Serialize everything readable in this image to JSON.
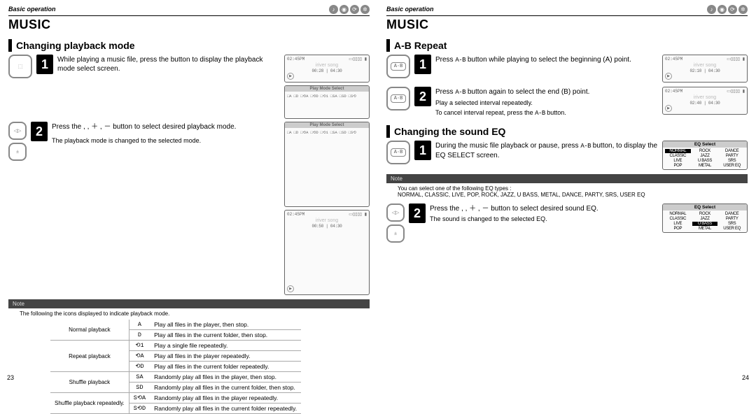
{
  "header": {
    "breadcrumb": "Basic operation",
    "icon_names": [
      "note",
      "globe",
      "clock",
      "gear"
    ]
  },
  "music_heading": "MUSIC",
  "left": {
    "section": "Changing playback mode",
    "step1": "While playing a music file, press the         button to display the playback mode select screen.",
    "step2_a": "Press the        ,     , ＋ , － button to select desired playback mode.",
    "step2_b": "The playback mode is changed to the selected mode.",
    "lcd1_mid": "iriver song",
    "lcd1_time": "00:28 | 04:30",
    "lcd_sel_title": "Play Mode Select",
    "lcd3_time": "00:50 | 04:30",
    "note_label": "Note",
    "note_intro": "The following the icons displayed to indicate playback mode.",
    "modes": [
      {
        "group": "Normal playback",
        "rows": [
          {
            "icon": "A",
            "desc": "Play all files in the player, then stop."
          },
          {
            "icon": "D",
            "desc": "Play all files in the current folder, then stop."
          }
        ]
      },
      {
        "group": "Repeat playback",
        "rows": [
          {
            "icon": "⟲1",
            "desc": "Play a single file repeatedly."
          },
          {
            "icon": "⟲A",
            "desc": "Play all files in the player repeatedly."
          },
          {
            "icon": "⟲D",
            "desc": "Play all files in the current folder repeatedly."
          }
        ]
      },
      {
        "group": "Shuffle playback",
        "rows": [
          {
            "icon": "SA",
            "desc": "Randomly play all files in the player, then stop."
          },
          {
            "icon": "SD",
            "desc": "Randomly play all files in the current folder, then stop."
          }
        ]
      },
      {
        "group": "Shuffle playback repeatedly.",
        "rows": [
          {
            "icon": "S⟲A",
            "desc": "Randomly play all files in the player repeatedly."
          },
          {
            "icon": "S⟲D",
            "desc": "Randomly play all files in the current folder repeatedly."
          }
        ]
      }
    ],
    "page_no": "23"
  },
  "right": {
    "section_ab": "A-B Repeat",
    "ab_btn": "A·B",
    "ab_sym": "A-B",
    "ab_step1": "Press A-B button while playing to select the beginning (A) point.",
    "ab_step2_a": "Press A-B button again to select the end (B) point.",
    "ab_step2_b": "Play a selected interval repeatedly.",
    "ab_step2_c": "To cancel interval repeat, press the A-B button.",
    "ab_lcd_time1": "02:10 | 04:30",
    "ab_lcd_time2": "02:40 | 04:30",
    "section_eq": "Changing the sound EQ",
    "eq_step1": "During the music file playback or pause, press A-B button, to display the EQ SELECT screen.",
    "eq_note_label": "Note",
    "eq_note_a": "You can select one of the following EQ types :",
    "eq_note_b": "NORMAL, CLASSIC, LIVE, POP, ROCK, JAZZ, U BASS, METAL, DANCE, PARTY, SRS, USER EQ",
    "eq_step2_a": "Press the        ,     , ＋ , － button to select desired sound EQ.",
    "eq_step2_b": "The sound is changed to the selected EQ.",
    "eq_title": "EQ Select",
    "eq_list": [
      "NORMAL",
      "ROCK",
      "DANCE",
      "CLASSIC",
      "JAZZ",
      "PARTY",
      "LIVE",
      "U BASS",
      "SRS",
      "POP",
      "METAL",
      "USER EQ"
    ],
    "eq_selected_1": "NORMAL",
    "eq_selected_2": "U BASS",
    "page_no": "24"
  }
}
